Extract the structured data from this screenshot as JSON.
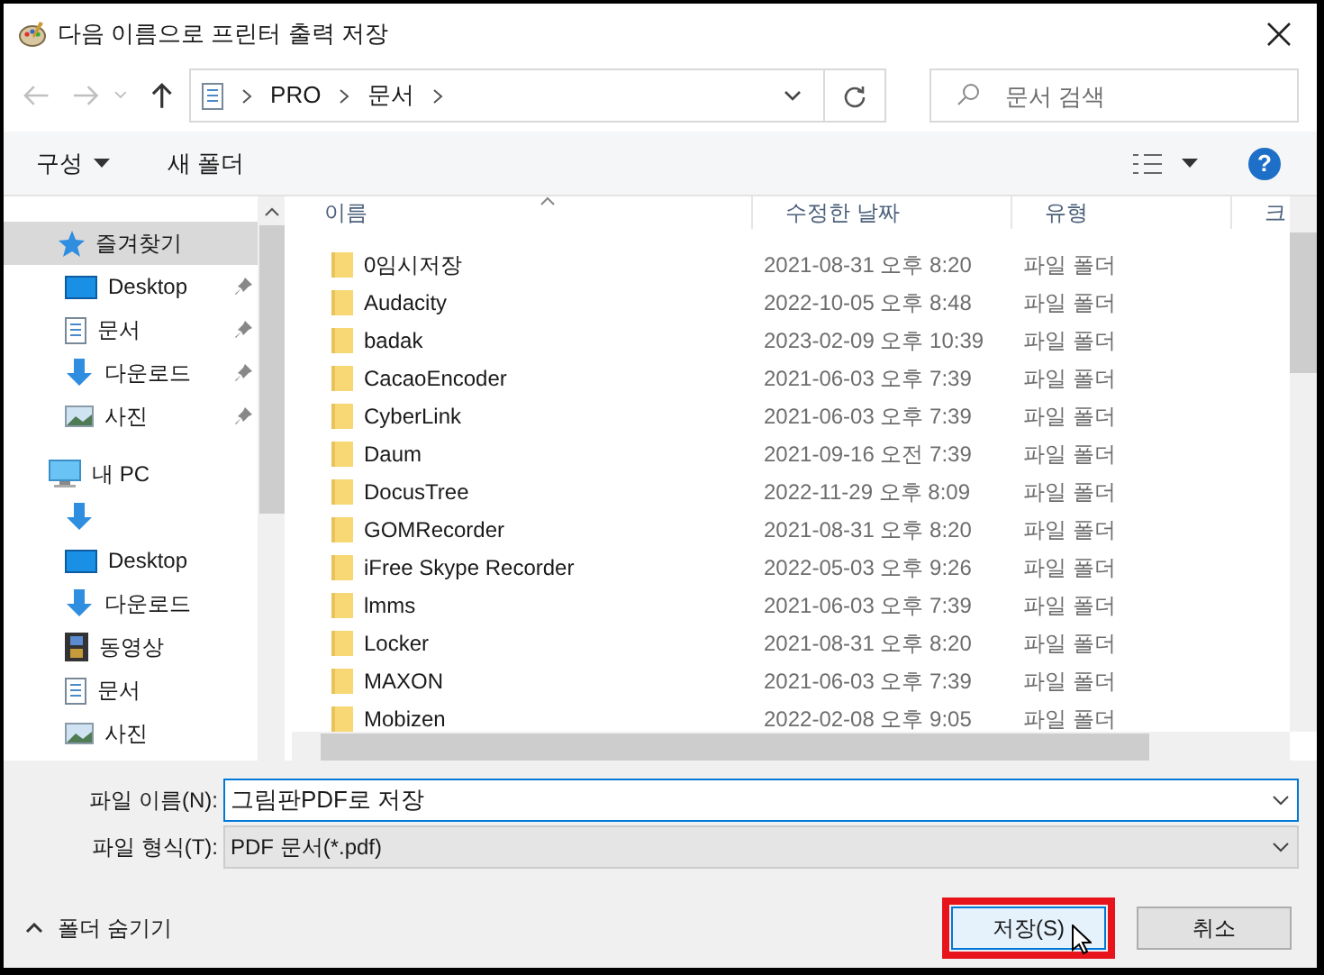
{
  "window": {
    "title": "다음 이름으로 프린터 출력 저장"
  },
  "address_bar": {
    "path": [
      "PRO",
      "문서"
    ]
  },
  "search": {
    "placeholder": "문서 검색"
  },
  "toolbar": {
    "organize": "구성",
    "new_folder": "새 폴더",
    "help": "?"
  },
  "sidebar": {
    "items": [
      {
        "label": "즐겨찾기",
        "kind": "favorites",
        "selected": true,
        "children": [
          {
            "label": "Desktop",
            "kind": "desktop",
            "selected": false,
            "pinned": true
          },
          {
            "label": "문서",
            "kind": "documents",
            "selected": false,
            "pinned": true
          },
          {
            "label": "다운로드",
            "kind": "downloads",
            "selected": false,
            "pinned": true
          },
          {
            "label": "사진",
            "kind": "pictures",
            "selected": false,
            "pinned": true
          }
        ]
      },
      {
        "label": "내 PC",
        "kind": "pc",
        "selected": false,
        "children": [
          {
            "kind": "downloads",
            "selected": false,
            "pinned": false
          },
          {
            "label": "Desktop",
            "kind": "desktop",
            "selected": false,
            "pinned": false
          },
          {
            "label": "다운로드",
            "kind": "downloads",
            "selected": false,
            "pinned": false
          },
          {
            "label": "동영상",
            "kind": "videos",
            "selected": false,
            "pinned": false
          },
          {
            "label": "문서",
            "kind": "documents",
            "selected": false,
            "pinned": false
          },
          {
            "label": "사진",
            "kind": "pictures",
            "selected": false,
            "pinned": false
          }
        ]
      }
    ]
  },
  "table": {
    "columns": [
      "이름",
      "수정한 날짜",
      "유형",
      "크"
    ],
    "rows": [
      [
        "0임시저장",
        "2021-08-31 오후 8:20",
        "파일 폴더"
      ],
      [
        "Audacity",
        "2022-10-05 오후 8:48",
        "파일 폴더"
      ],
      [
        "badak",
        "2023-02-09 오후 10:39",
        "파일 폴더"
      ],
      [
        "CacaoEncoder",
        "2021-06-03 오후 7:39",
        "파일 폴더"
      ],
      [
        "CyberLink",
        "2021-06-03 오후 7:39",
        "파일 폴더"
      ],
      [
        "Daum",
        "2021-09-16 오전 7:39",
        "파일 폴더"
      ],
      [
        "DocusTree",
        "2022-11-29 오후 8:09",
        "파일 폴더"
      ],
      [
        "GOMRecorder",
        "2021-08-31 오후 8:20",
        "파일 폴더"
      ],
      [
        "iFree Skype Recorder",
        "2022-05-03 오후 9:26",
        "파일 폴더"
      ],
      [
        "lmms",
        "2021-06-03 오후 7:39",
        "파일 폴더"
      ],
      [
        "Locker",
        "2021-08-31 오후 8:20",
        "파일 폴더"
      ],
      [
        "MAXON",
        "2021-06-03 오후 7:39",
        "파일 폴더"
      ],
      [
        "Mobizen",
        "2022-02-08 오후 9:05",
        "파일 폴더"
      ]
    ]
  },
  "file_name": {
    "label": "파일 이름(N):",
    "value": "그림판PDF로 저장"
  },
  "file_type": {
    "label": "파일 형식(T):",
    "value": "PDF 문서(*.pdf)"
  },
  "hide_folders": "폴더 숨기기",
  "buttons": [
    {
      "label": "저장(S)",
      "kind": "primary",
      "highlighted": true
    },
    {
      "label": "취소",
      "kind": "secondary",
      "highlighted": false
    }
  ]
}
